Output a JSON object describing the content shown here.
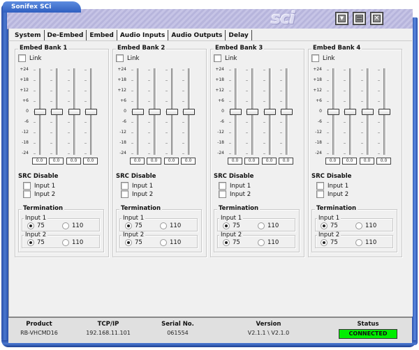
{
  "window": {
    "title": "Sonifex SCi",
    "logo_text": "sci",
    "controls": [
      {
        "name": "minimize-to-tray",
        "glyph": "▼"
      },
      {
        "name": "maximize",
        "glyph": "▬"
      },
      {
        "name": "close",
        "glyph": "✕"
      }
    ]
  },
  "tabs": [
    {
      "label": "System",
      "active": false
    },
    {
      "label": "De-Embed",
      "active": false
    },
    {
      "label": "Embed",
      "active": false
    },
    {
      "label": "Audio Inputs",
      "active": true
    },
    {
      "label": "Audio Outputs",
      "active": false
    },
    {
      "label": "Delay",
      "active": false
    }
  ],
  "scale_labels": [
    "+24",
    "+18",
    "+12",
    "+6",
    "0",
    "-6",
    "-12",
    "-18",
    "-24"
  ],
  "banks": [
    {
      "title": "Embed Bank 1",
      "link_label": "Link",
      "link_checked": false,
      "fader_values_db": [
        0,
        0,
        0,
        0
      ],
      "fader_readouts": [
        "0.0",
        "0.0",
        "0.0",
        "0.0"
      ],
      "src_disable_title": "SRC Disable",
      "src_inputs": [
        {
          "label": "Input 1",
          "checked": false
        },
        {
          "label": "Input 2",
          "checked": false
        }
      ],
      "termination_title": "Termination",
      "termination": [
        {
          "label": "Input 1",
          "options": [
            "75",
            "110"
          ],
          "selected": "75"
        },
        {
          "label": "Input 2",
          "options": [
            "75",
            "110"
          ],
          "selected": "75"
        }
      ]
    },
    {
      "title": "Embed Bank 2",
      "link_label": "Link",
      "link_checked": false,
      "fader_values_db": [
        0,
        0,
        0,
        0
      ],
      "fader_readouts": [
        "0.0",
        "0.0",
        "0.0",
        "0.0"
      ],
      "src_disable_title": "SRC Disable",
      "src_inputs": [
        {
          "label": "Input 1",
          "checked": false
        },
        {
          "label": "Input 2",
          "checked": false
        }
      ],
      "termination_title": "Termination",
      "termination": [
        {
          "label": "Input 1",
          "options": [
            "75",
            "110"
          ],
          "selected": "75"
        },
        {
          "label": "Input 2",
          "options": [
            "75",
            "110"
          ],
          "selected": "75"
        }
      ]
    },
    {
      "title": "Embed Bank 3",
      "link_label": "Link",
      "link_checked": false,
      "fader_values_db": [
        0,
        0,
        0,
        0
      ],
      "fader_readouts": [
        "0.0",
        "0.0",
        "0.0",
        "0.0"
      ],
      "src_disable_title": "SRC Disable",
      "src_inputs": [
        {
          "label": "Input 1",
          "checked": false
        },
        {
          "label": "Input 2",
          "checked": false
        }
      ],
      "termination_title": "Termination",
      "termination": [
        {
          "label": "Input 1",
          "options": [
            "75",
            "110"
          ],
          "selected": "75"
        },
        {
          "label": "Input 2",
          "options": [
            "75",
            "110"
          ],
          "selected": "75"
        }
      ]
    },
    {
      "title": "Embed Bank 4",
      "link_label": "Link",
      "link_checked": false,
      "fader_values_db": [
        0,
        0,
        0,
        0
      ],
      "fader_readouts": [
        "0.0",
        "0.0",
        "0.0",
        "0.0"
      ],
      "src_disable_title": "SRC Disable",
      "src_inputs": [
        {
          "label": "Input 1",
          "checked": false
        },
        {
          "label": "Input 2",
          "checked": false
        }
      ],
      "termination_title": "Termination",
      "termination": [
        {
          "label": "Input 1",
          "options": [
            "75",
            "110"
          ],
          "selected": "75"
        },
        {
          "label": "Input 2",
          "options": [
            "75",
            "110"
          ],
          "selected": "75"
        }
      ]
    }
  ],
  "footer": {
    "product": {
      "label": "Product",
      "value": "RB-VHCMD16"
    },
    "tcpip": {
      "label": "TCP/IP",
      "value": "192.168.11.101"
    },
    "serial": {
      "label": "Serial No.",
      "value": "061554"
    },
    "version": {
      "label": "Version",
      "value": "V2.1.1 \\ V2.1.0"
    },
    "status": {
      "label": "Status",
      "value": "CONNECTED",
      "color": "#00ee00"
    }
  }
}
